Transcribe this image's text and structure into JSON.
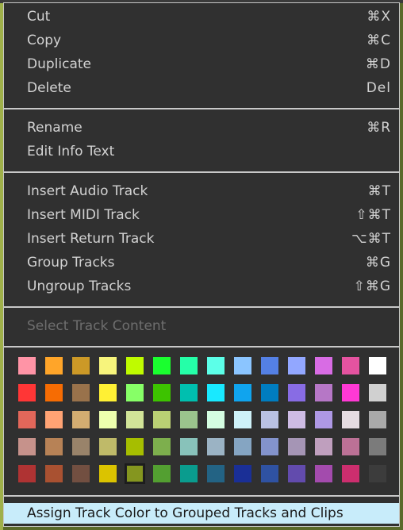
{
  "menu": {
    "groups": [
      [
        {
          "label": "Cut",
          "shortcut": "⌘X"
        },
        {
          "label": "Copy",
          "shortcut": "⌘C"
        },
        {
          "label": "Duplicate",
          "shortcut": "⌘D"
        },
        {
          "label": "Delete",
          "shortcut": "Del"
        }
      ],
      [
        {
          "label": "Rename",
          "shortcut": "⌘R"
        },
        {
          "label": "Edit Info Text",
          "shortcut": ""
        }
      ],
      [
        {
          "label": "Insert Audio Track",
          "shortcut": "⌘T"
        },
        {
          "label": "Insert MIDI Track",
          "shortcut": "⇧⌘T"
        },
        {
          "label": "Insert Return Track",
          "shortcut": "⌥⌘T"
        },
        {
          "label": "Group Tracks",
          "shortcut": "⌘G"
        },
        {
          "label": "Ungroup Tracks",
          "shortcut": "⇧⌘G"
        }
      ],
      [
        {
          "label": "Select Track Content",
          "shortcut": "",
          "disabled": true
        }
      ]
    ],
    "color_palette": {
      "selected": [
        4,
        4
      ],
      "rows": [
        [
          "#ff94a6",
          "#ffa529",
          "#cc9927",
          "#f7f47c",
          "#bffb00",
          "#1aff2f",
          "#25ffa8",
          "#5cffe8",
          "#8bc5ff",
          "#5480e4",
          "#92a7ff",
          "#d86ce4",
          "#e553a0",
          "#ffffff"
        ],
        [
          "#ff3636",
          "#f66c03",
          "#99724b",
          "#fff034",
          "#87ff67",
          "#3dc300",
          "#00bfaf",
          "#19e9ff",
          "#10a4ee",
          "#007dc0",
          "#886ce4",
          "#b677c6",
          "#ff39d4",
          "#d0d0d0"
        ],
        [
          "#e2675a",
          "#ffa374",
          "#d3ad71",
          "#edffae",
          "#d2e498",
          "#bad074",
          "#9bc48d",
          "#d4fde1",
          "#cdf1f8",
          "#b9c1e3",
          "#cdbbe4",
          "#ae98e5",
          "#e5dce1",
          "#a9a9a9"
        ],
        [
          "#c6928b",
          "#b78256",
          "#99836a",
          "#bfba69",
          "#a6be00",
          "#7daf4d",
          "#88c2ba",
          "#9bb3c4",
          "#85a5c2",
          "#8393cc",
          "#a595b5",
          "#bf9fbe",
          "#bc7196",
          "#7b7b7b"
        ],
        [
          "#af3333",
          "#a95131",
          "#724f41",
          "#dbc300",
          "#85961f",
          "#539f31",
          "#0a9c8e",
          "#236384",
          "#1a2f96",
          "#2f52a2",
          "#624bad",
          "#a34bad",
          "#cc2e6e",
          "#3c3c3c"
        ]
      ]
    },
    "footer_item": {
      "label": "Assign Track Color to Grouped Tracks and Clips",
      "highlighted": true
    }
  }
}
